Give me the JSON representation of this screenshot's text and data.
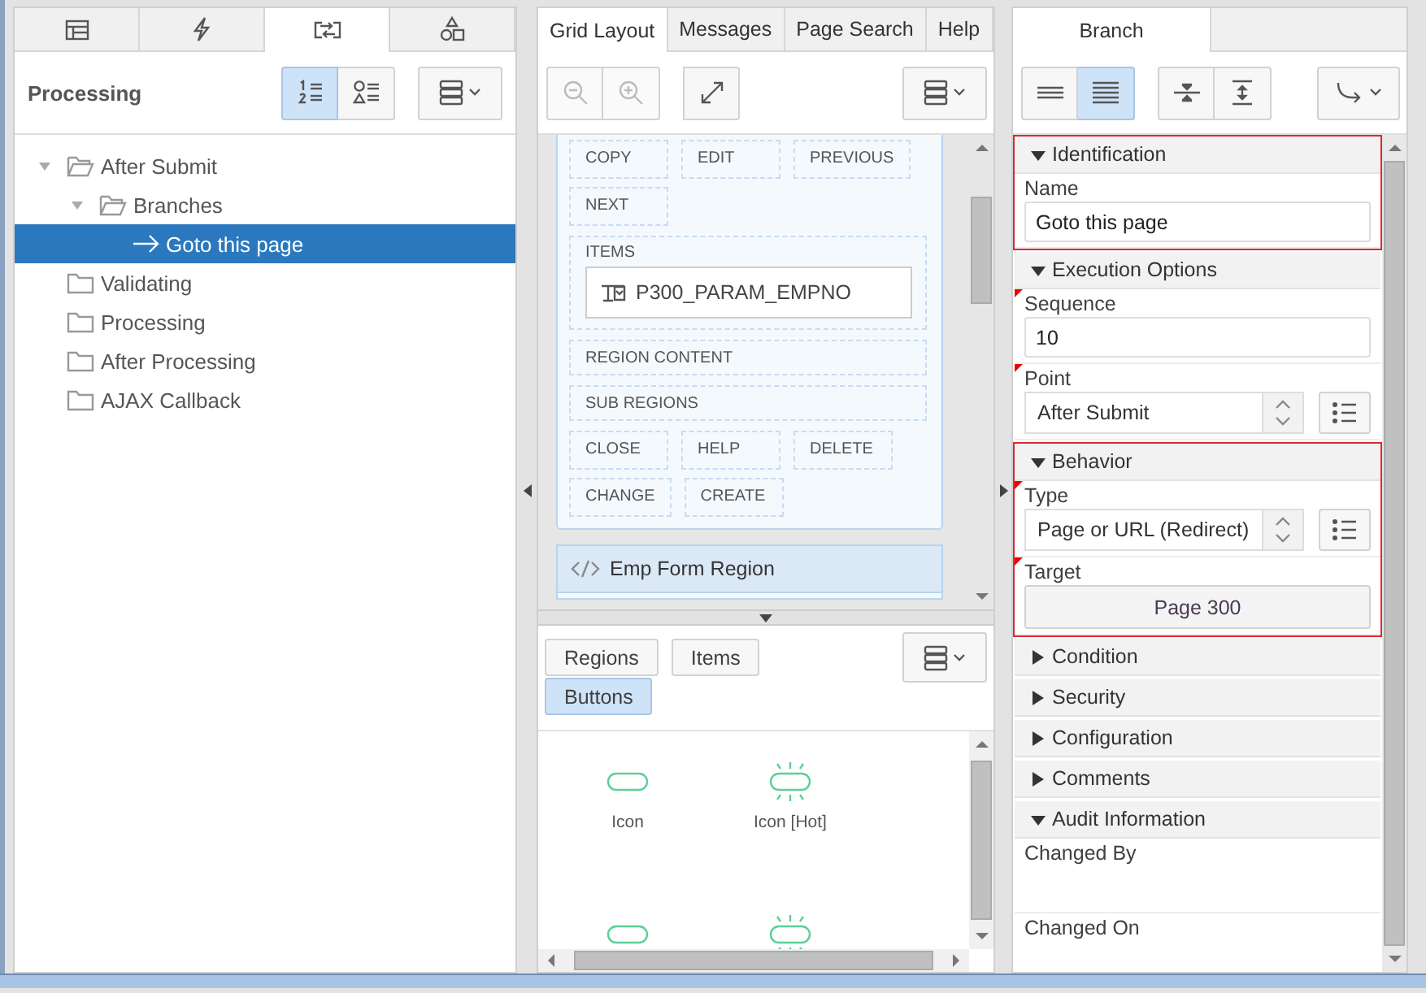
{
  "left_panel": {
    "tabs": [
      {
        "kind": "table",
        "selected": false
      },
      {
        "kind": "lightning",
        "selected": false
      },
      {
        "kind": "swap",
        "selected": true
      },
      {
        "kind": "shapes",
        "selected": false
      }
    ],
    "title": "Processing",
    "view_buttons": [
      {
        "kind": "numbered",
        "selected": true
      },
      {
        "kind": "shapes",
        "selected": false
      }
    ],
    "tree": [
      {
        "label": "After Submit",
        "kind": "folder",
        "expanded": true,
        "selected": false,
        "children": [
          {
            "label": "Branches",
            "kind": "folder",
            "expanded": true,
            "selected": false,
            "children": [
              {
                "label": "Goto this page",
                "kind": "branch",
                "selected": true
              }
            ]
          }
        ]
      },
      {
        "label": "Validating",
        "kind": "folder",
        "selected": false
      },
      {
        "label": "Processing",
        "kind": "folder",
        "selected": false
      },
      {
        "label": "After Processing",
        "kind": "folder",
        "selected": false
      },
      {
        "label": "AJAX Callback",
        "kind": "folder",
        "selected": false
      }
    ]
  },
  "center_panel": {
    "tabs": [
      {
        "label": "Grid Layout",
        "selected": true
      },
      {
        "label": "Messages",
        "selected": false
      },
      {
        "label": "Page Search",
        "selected": false
      },
      {
        "label": "Help",
        "selected": false
      }
    ],
    "tools": [
      {
        "kind": "zoom-out",
        "disabled": true
      },
      {
        "kind": "zoom-in",
        "disabled": true
      },
      {
        "kind": "expand",
        "disabled": false
      }
    ],
    "region_sections": [
      {
        "kind": "buttons",
        "labels": [
          "COPY",
          "EDIT",
          "PREVIOUS",
          "NEXT"
        ]
      },
      {
        "kind": "items",
        "label": "ITEMS",
        "items": [
          "P300_PARAM_EMPNO"
        ]
      },
      {
        "kind": "slot",
        "label": "REGION CONTENT"
      },
      {
        "kind": "slot",
        "label": "SUB REGIONS"
      },
      {
        "kind": "buttons",
        "labels": [
          "CLOSE",
          "HELP",
          "DELETE",
          "CHANGE",
          "CREATE"
        ]
      }
    ],
    "next_region": "Emp Form Region",
    "gallery": {
      "filters": [
        {
          "label": "Regions",
          "selected": false
        },
        {
          "label": "Items",
          "selected": false
        },
        {
          "label": "Buttons",
          "selected": true
        }
      ],
      "entries": [
        {
          "kind": "plain",
          "label": "Icon"
        },
        {
          "kind": "hot",
          "label": "Icon [Hot]"
        },
        {
          "kind": "plain"
        },
        {
          "kind": "hot"
        }
      ]
    }
  },
  "right_panel": {
    "tab": {
      "label": "Branch",
      "selected": true
    },
    "display_buttons": [
      {
        "kind": "lines",
        "selected": false
      },
      {
        "kind": "dense",
        "selected": true
      }
    ],
    "groups": [
      {
        "title": "Identification",
        "expanded": true,
        "highlighted": true,
        "fields": [
          {
            "label": "Name",
            "kind": "text",
            "value": "Goto this page",
            "required": false
          }
        ]
      },
      {
        "title": "Execution Options",
        "expanded": true,
        "highlighted": false,
        "fields": [
          {
            "label": "Sequence",
            "kind": "text",
            "value": "10",
            "required": true
          },
          {
            "label": "Point",
            "kind": "select",
            "value": "After Submit",
            "required": true
          }
        ]
      },
      {
        "title": "Behavior",
        "expanded": true,
        "highlighted": true,
        "fields": [
          {
            "label": "Type",
            "kind": "select",
            "value": "Page or URL (Redirect)",
            "required": true
          },
          {
            "label": "Target",
            "kind": "link",
            "value": "Page 300",
            "required": true
          }
        ]
      },
      {
        "title": "Condition",
        "expanded": false,
        "highlighted": false
      },
      {
        "title": "Security",
        "expanded": false,
        "highlighted": false
      },
      {
        "title": "Configuration",
        "expanded": false,
        "highlighted": false
      },
      {
        "title": "Comments",
        "expanded": false,
        "highlighted": false
      },
      {
        "title": "Audit Information",
        "expanded": true,
        "highlighted": false,
        "fields": [
          {
            "label": "Changed By",
            "kind": "display",
            "required": false
          },
          {
            "label": "Changed On",
            "kind": "display",
            "required": false
          }
        ]
      }
    ]
  }
}
